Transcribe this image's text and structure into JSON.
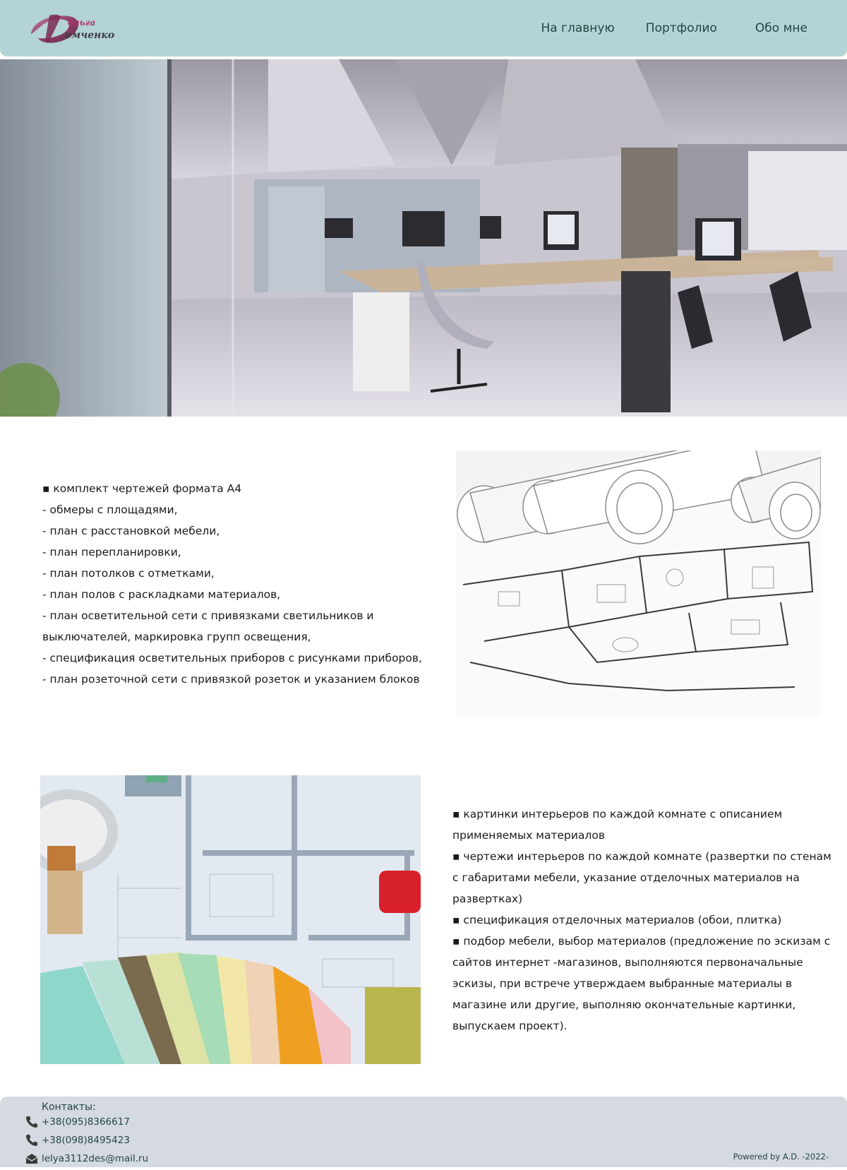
{
  "header": {
    "logo_alt": "Ольга Демченко",
    "nav": [
      {
        "label": "На главную"
      },
      {
        "label": "Портфолио"
      },
      {
        "label": "Обо мне"
      }
    ]
  },
  "section1": {
    "lines": [
      "▪ комплект чертежей формата А4",
      "- обмеры с площадями,",
      "- план с расстановкой мебели,",
      "- план перепланировки,",
      "- план потолков с отметками,",
      "- план полов с раскладками материалов,",
      "- план осветительной сети с привязками светильников и",
      "выключателей, маркировка групп освещения,",
      "- спецификация осветительных приборов с рисунками приборов,",
      "- план розеточной сети с привязкой розеток и указанием блоков"
    ]
  },
  "section2": {
    "lines": [
      "▪ картинки интерьеров по каждой комнате с описанием",
      "применяемых материалов",
      "▪ чертежи интерьеров по каждой комнате (развертки по стенам",
      "с габаритами мебели, указание отделочных материалов на",
      "развертках)",
      "▪ спецификация отделочных материалов (обои, плитка)",
      "▪ подбор мебели, выбор материалов (предложение по эскизам с",
      "сайтов интернет -магазинов, выполняются первоначальные",
      "эскизы, при встрече утверждаем выбранные материалы в",
      "магазине или другие, выполняю окончательные картинки,",
      "выпускаем проект)."
    ]
  },
  "footer": {
    "contacts_title": "Контакты:",
    "phone1": "+38(095)8366617",
    "phone2": "+38(098)8495423",
    "email": "lelya3112des@mail.ru",
    "powered": "Powered by A.D. -2022-"
  },
  "icons": {
    "phone": "phone-icon",
    "email": "envelope-icon"
  },
  "colors": {
    "header_bg": "#b3d3d4",
    "footer_bg": "#d4dadf",
    "nav_text": "#254545",
    "logo_accent": "#9b2d5d"
  }
}
